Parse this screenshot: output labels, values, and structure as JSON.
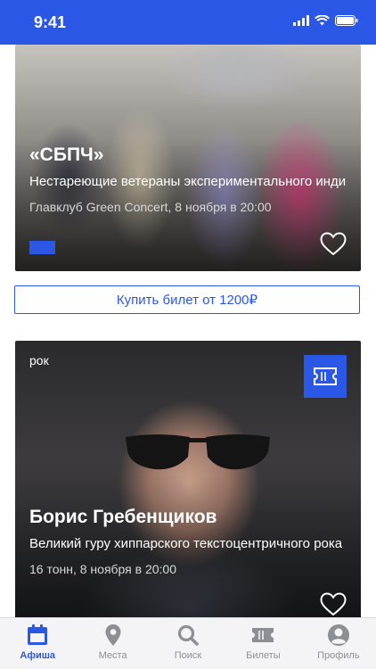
{
  "status": {
    "time": "9:41"
  },
  "events": [
    {
      "title": "«СБПЧ»",
      "description": "Нестареющие ветераны экспериментального инди",
      "meta": "Главклуб Green Concert, 8 ноября в 20:00"
    },
    {
      "genre": "рок",
      "title": "Борис Гребенщиков",
      "description": "Великий гуру хиппарского текстоцентричного рока",
      "meta": "16 тонн, 8 ноября в 20:00"
    }
  ],
  "buy_button": "Купить билет от 1200₽",
  "tabs": [
    {
      "label": "Афиша",
      "icon": "calendar-icon",
      "active": true
    },
    {
      "label": "Места",
      "icon": "map-pin-icon",
      "active": false
    },
    {
      "label": "Поиск",
      "icon": "search-icon",
      "active": false
    },
    {
      "label": "Билеты",
      "icon": "ticket-icon",
      "active": false
    },
    {
      "label": "Профиль",
      "icon": "profile-icon",
      "active": false
    }
  ],
  "colors": {
    "accent": "#2b57e6",
    "inactive": "#8e8e95"
  }
}
